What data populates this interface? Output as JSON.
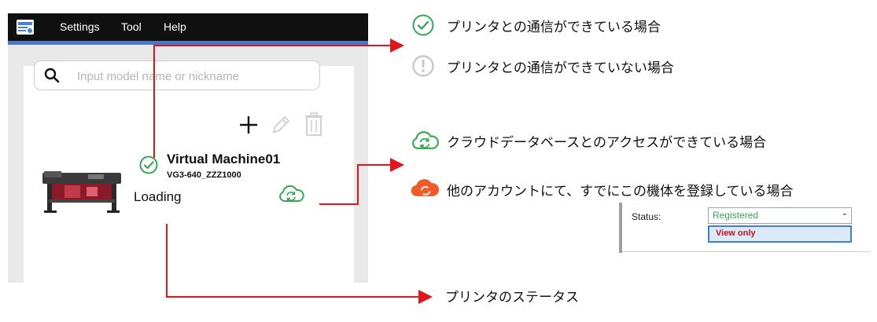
{
  "menubar": {
    "items": [
      "Settings",
      "Tool",
      "Help"
    ]
  },
  "search": {
    "placeholder": "Input model name or nickname",
    "icon": "search-icon"
  },
  "toolbar": {
    "icons": [
      "add-icon",
      "edit-icon",
      "delete-icon"
    ]
  },
  "machine": {
    "name": "Virtual Machine01",
    "model": "VG3-640_ZZZ1000",
    "status_text": "Loading",
    "connection_icon": "check-circle-icon",
    "cloud_icon": "cloud-sync-icon"
  },
  "legend": {
    "connected": "プリンタとの通信ができている場合",
    "disconnected": "プリンタとの通信ができていない場合",
    "cloud_connected": "クラウドデータベースとのアクセスができている場合",
    "cloud_other_account": "他のアカウントにて、すでにこの機体を登録している場合",
    "printer_status": "プリンタのステータス"
  },
  "status_dropdown": {
    "label": "Status:",
    "selected": "Registered",
    "option": "View only"
  },
  "colors": {
    "menubar": "#101010",
    "accent": "#4876c9",
    "ok_green": "#34a853",
    "warn_gray": "#c8c8c8",
    "cloud_orange": "#f05a28",
    "callout_red": "#e0161c"
  }
}
